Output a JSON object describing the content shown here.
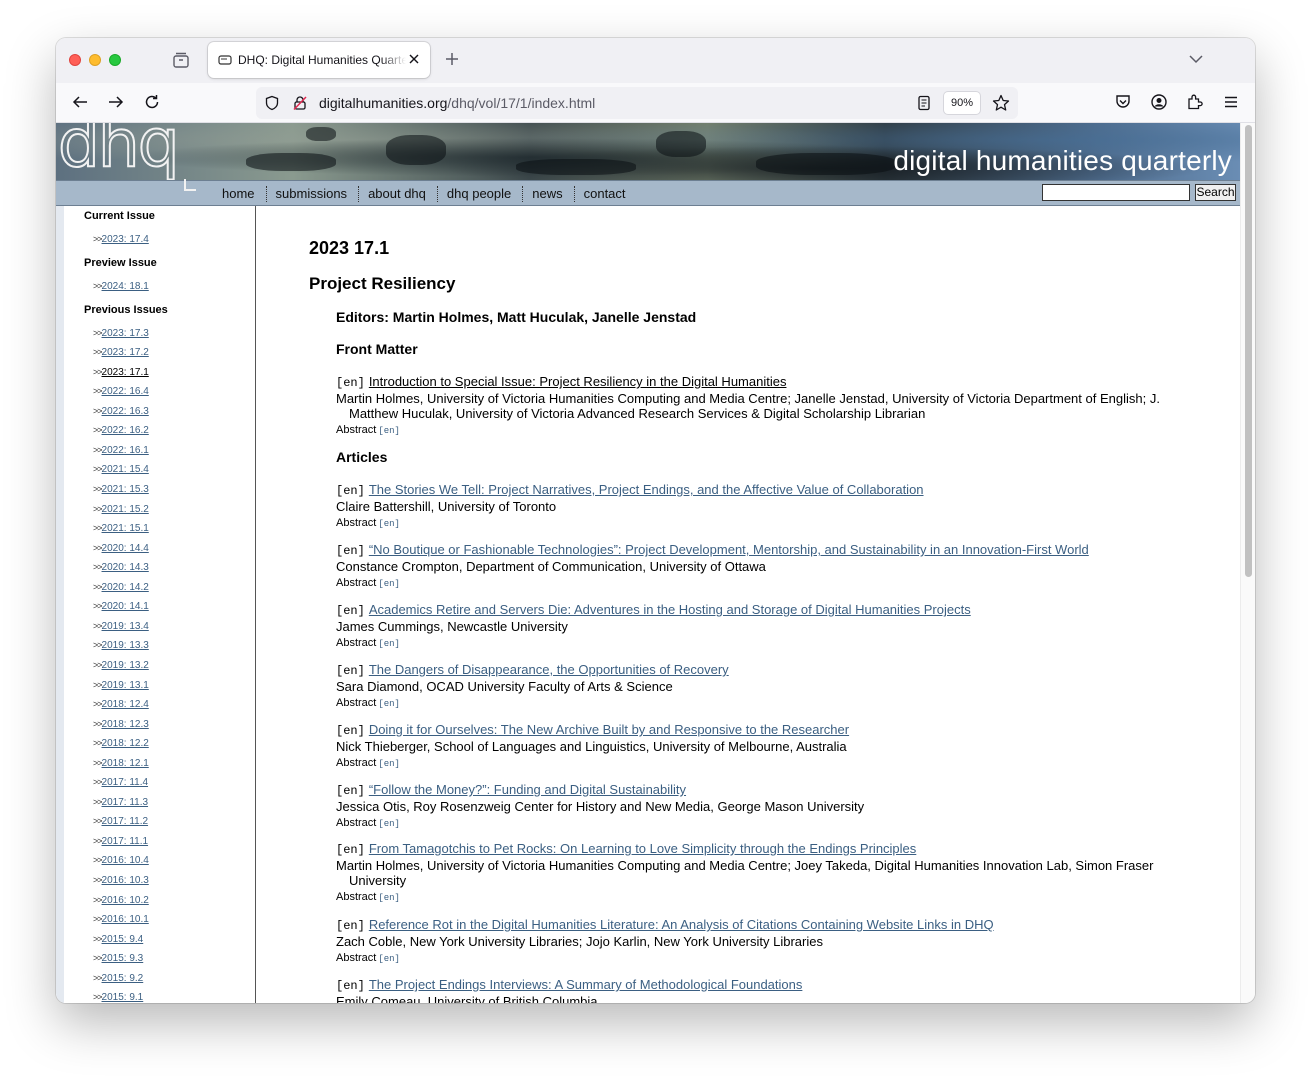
{
  "browser": {
    "tab_title": "DHQ: Digital Humanities Quarterly",
    "url_domain": "digitalhumanities.org",
    "url_path": "/dhq/vol/17/1/index.html",
    "zoom": "90%"
  },
  "site": {
    "logo": "dhq",
    "tagline": "digital humanities quarterly",
    "nav": [
      "home",
      "submissions",
      "about dhq",
      "dhq people",
      "news",
      "contact"
    ],
    "search_button": "Search",
    "search_value": ""
  },
  "sidebar": {
    "current_heading": "Current Issue",
    "current_items": [
      "2023: 17.4"
    ],
    "preview_heading": "Preview Issue",
    "preview_items": [
      "2024: 18.1"
    ],
    "previous_heading": "Previous Issues",
    "previous_items": [
      "2023: 17.3",
      "2023: 17.2",
      "2023: 17.1",
      "2022: 16.4",
      "2022: 16.3",
      "2022: 16.2",
      "2022: 16.1",
      "2021: 15.4",
      "2021: 15.3",
      "2021: 15.2",
      "2021: 15.1",
      "2020: 14.4",
      "2020: 14.3",
      "2020: 14.2",
      "2020: 14.1",
      "2019: 13.4",
      "2019: 13.3",
      "2019: 13.2",
      "2019: 13.1",
      "2018: 12.4",
      "2018: 12.3",
      "2018: 12.2",
      "2018: 12.1",
      "2017: 11.4",
      "2017: 11.3",
      "2017: 11.2",
      "2017: 11.1",
      "2016: 10.4",
      "2016: 10.3",
      "2016: 10.2",
      "2016: 10.1",
      "2015: 9.4",
      "2015: 9.3",
      "2015: 9.2",
      "2015: 9.1"
    ],
    "arrow": ">>",
    "current_issue": "2023: 17.1"
  },
  "issue": {
    "title": "2023 17.1",
    "subtitle": "Project Resiliency",
    "editors": "Editors: Martin Holmes, Matt Huculak, Janelle Jenstad",
    "front_matter_heading": "Front Matter",
    "articles_heading": "Articles",
    "lang_tag": "[en]",
    "abstract_label": "Abstract",
    "abstract_lang": "[en]",
    "front_matter": [
      {
        "title": "Introduction to Special Issue: Project Resiliency in the Digital Humanities",
        "authors": "Martin Holmes, University of Victoria Humanities Computing and Media Centre; Janelle Jenstad, University of Victoria Department of English; J. Matthew Huculak, University of Victoria Advanced Research Services & Digital Scholarship Librarian"
      }
    ],
    "articles": [
      {
        "title": "The Stories We Tell: Project Narratives, Project Endings, and the Affective Value of Collaboration",
        "authors": "Claire Battershill, University of Toronto"
      },
      {
        "title": "“No Boutique or Fashionable Technologies”: Project Development, Mentorship, and Sustainability in an Innovation-First World",
        "authors": "Constance Crompton, Department of Communication, University of Ottawa"
      },
      {
        "title": "Academics Retire and Servers Die: Adventures in the Hosting and Storage of Digital Humanities Projects",
        "authors": "James Cummings, Newcastle University"
      },
      {
        "title": "The Dangers of Disappearance, the Opportunities of Recovery",
        "authors": "Sara Diamond, OCAD University Faculty of Arts & Science"
      },
      {
        "title": "Doing it for Ourselves: The New Archive Built by and Responsive to the Researcher",
        "authors": "Nick Thieberger, School of Languages and Linguistics, University of Melbourne, Australia"
      },
      {
        "title": "“Follow the Money?”: Funding and Digital Sustainability",
        "authors": "Jessica Otis, Roy Rosenzweig Center for History and New Media, George Mason University"
      },
      {
        "title": "From Tamagotchis to Pet Rocks: On Learning to Love Simplicity through the Endings Principles",
        "authors": "Martin Holmes, University of Victoria Humanities Computing and Media Centre; Joey Takeda, Digital Humanities Innovation Lab, Simon Fraser University"
      },
      {
        "title": "Reference Rot in the Digital Humanities Literature: An Analysis of Citations Containing Website Links in DHQ",
        "authors": "Zach Coble, New York University Libraries; Jojo Karlin, New York University Libraries"
      },
      {
        "title": "The Project Endings Interviews: A Summary of Methodological Foundations",
        "authors": "Emily Comeau, University of British Columbia"
      }
    ]
  }
}
